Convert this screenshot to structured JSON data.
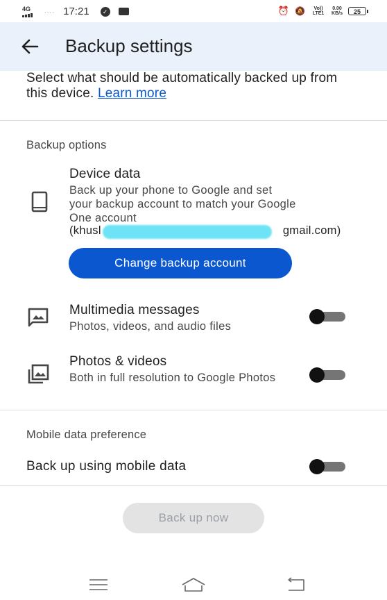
{
  "status_bar": {
    "network_label": "4G",
    "time": "17:21",
    "lte_label": "Vo)) LTE1",
    "speed_value": "0.00",
    "speed_unit": "KB/s",
    "battery": "25"
  },
  "app_bar": {
    "title": "Backup settings"
  },
  "intro": {
    "text": "Select what should be automatically backed up from this device.",
    "link": "Learn more"
  },
  "backup_options": {
    "header": "Backup options",
    "device_data": {
      "title": "Device data",
      "description": "Back up your phone to Google and set your backup account to match your Google One account",
      "email_prefix": "(khusl",
      "email_suffix": "gmail.com)",
      "button": "Change backup account"
    },
    "multimedia": {
      "title": "Multimedia messages",
      "description": "Photos, videos, and audio files",
      "enabled": false
    },
    "photos": {
      "title": "Photos & videos",
      "description": "Both in full resolution to Google Photos",
      "enabled": false
    }
  },
  "mobile_data": {
    "header": "Mobile data preference",
    "title": "Back up using mobile data",
    "enabled": false
  },
  "actions": {
    "backup_now": "Back up now"
  },
  "icons": {
    "back": "arrow-left-icon",
    "device": "phone-icon",
    "mms": "image-message-icon",
    "photos": "photo-library-icon"
  }
}
